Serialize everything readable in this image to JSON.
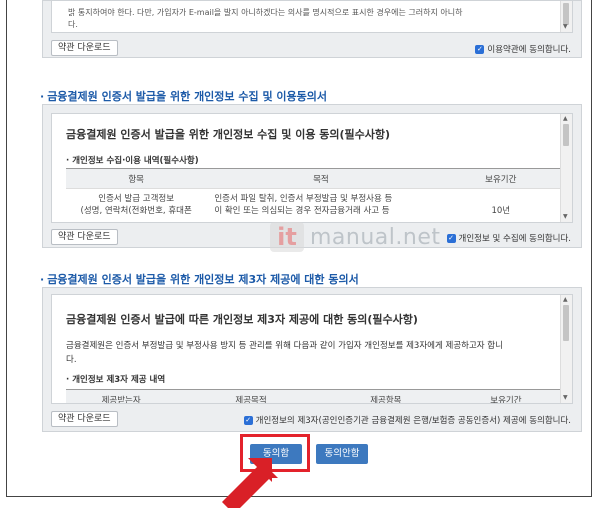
{
  "terms_box": {
    "text_line1": "밝 통지하여야 한다. 다만, 가입자가 E-mail을 발지 아니하겠다는 의사를 명시적으로 표시한 경우에는 그러하지 아니하",
    "text_line2": "다.",
    "download_label": "약관 다운로드",
    "agree_label": "이용약관에 동의합니다."
  },
  "section1": {
    "title": "금융결제원 인증서 발급을 위한 개인정보 수집 및 이용동의서",
    "inner_title": "금융결제원 인증서 발급을 위한 개인정보 수집 및 이용 동의(필수사항)",
    "sub_title": "개인정보 수집·이용 내역(필수사항)",
    "table": {
      "headers": [
        "항목",
        "목적",
        "보유기간"
      ],
      "row": {
        "item_line1": "인증서 발급 고객정보",
        "item_line2": "(성명, 연락처(전화번호, 휴대폰",
        "purpose_line1": "인증서 파일 탈취, 인증서 부정발급 및 부정사용 등",
        "purpose_line2": "이 확인 또는 의심되는 경우 전자금융거래 사고 등",
        "period": "10년"
      }
    },
    "download_label": "약관 다운로드",
    "agree_label": "개인정보 및 수집에 동의합니다."
  },
  "section2": {
    "title": "금융결제원 인증서 발급을 위한 개인정보 제3자 제공에 대한 동의서",
    "inner_title": "금융결제원 인증서 발급에 따른 개인정보 제3자 제공에 대한 동의(필수사항)",
    "description": "금융결제원은 인증서 부정발급 및 부정사용 방지 등 관리를 위해 다음과 같이 가입자 개인정보를 제3자에게 제공하고자 합니",
    "description2": "다.",
    "sub_title": "개인정보 제3자 제공 내역",
    "table": {
      "headers": [
        "제공받는자",
        "제공목적",
        "제공항목",
        "보유기간"
      ]
    },
    "download_label": "약관 다운로드",
    "agree_label": "개인정보의 제3자(공인인증기관 금융결제원 은행/보험증 공동인증서) 제공에 동의합니다."
  },
  "watermark": {
    "logo": "it",
    "text": "manual.net"
  },
  "actions": {
    "agree_label": "동의함",
    "disagree_label": "동의안함"
  },
  "colors": {
    "accent": "#1c5aa8",
    "button": "#3d79bf",
    "highlight": "#e3222b",
    "checkbox": "#2b6fd6"
  }
}
